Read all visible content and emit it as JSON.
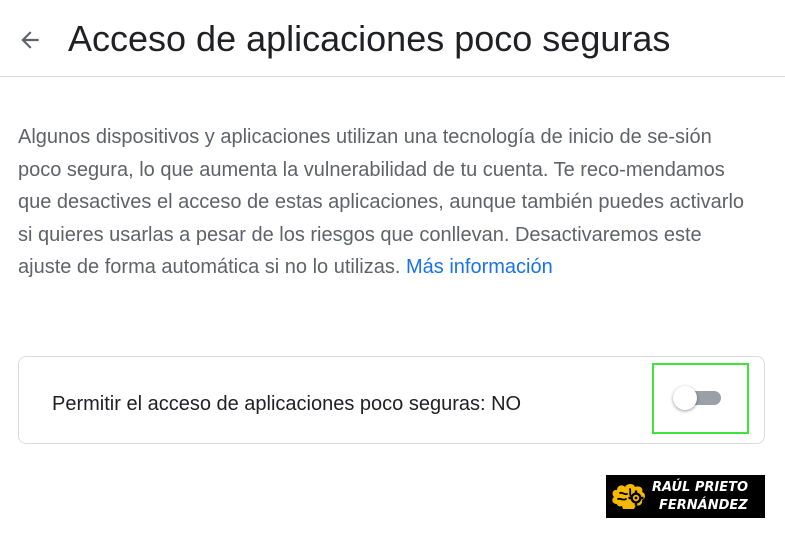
{
  "header": {
    "back_icon": "arrow-back-icon",
    "title": "Acceso de aplicaciones poco seguras"
  },
  "description": {
    "text": "Algunos dispositivos y aplicaciones utilizan una tecnología de inicio de se-sión poco segura, lo que aumenta la vulnerabilidad de tu cuenta. Te reco-mendamos que desactives el acceso de estas aplicaciones, aunque también puedes activarlo si quieres usarlas a pesar de los riesgos que conllevan. Desactivaremos este ajuste de forma automática si no lo utilizas.",
    "link_text": "Más información"
  },
  "setting": {
    "label": "Permitir el acceso de aplicaciones poco seguras: NO",
    "toggle_on": false
  },
  "watermark": {
    "line1": "RAÚL PRIETO",
    "line2": "FERNÁNDEZ",
    "logo_icon": "brain-gear-icon"
  },
  "colors": {
    "link": "#1a73e8",
    "highlight": "#3ee33e",
    "logo": "#f5b800"
  }
}
